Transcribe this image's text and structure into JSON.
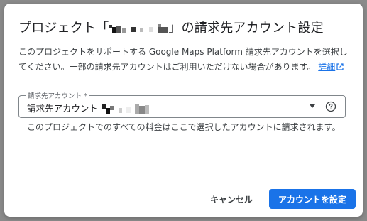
{
  "dialog": {
    "title_prefix": "プロジェクト「",
    "title_suffix": "」の請求先アカウント設定",
    "description": "このプロジェクトをサポートする Google Maps Platform 請求先アカウントを選択してください。一部の請求先アカウントはご利用いただけない場合があります。",
    "details_link": "詳細",
    "field": {
      "label": "請求先アカウント *",
      "value_prefix": "請求先アカウント"
    },
    "hint": "このプロジェクトでのすべての料金はここで選択したアカウントに請求されます。",
    "cancel_label": "キャンセル",
    "submit_label": "アカウントを設定"
  },
  "colors": {
    "primary": "#1a73e8",
    "text": "#202124",
    "secondary_text": "#3c4043",
    "overlay": "#8a8a8a"
  },
  "icons": {
    "external_link": "external-link-icon",
    "dropdown": "dropdown-arrow-icon",
    "help": "help-circle-icon"
  }
}
